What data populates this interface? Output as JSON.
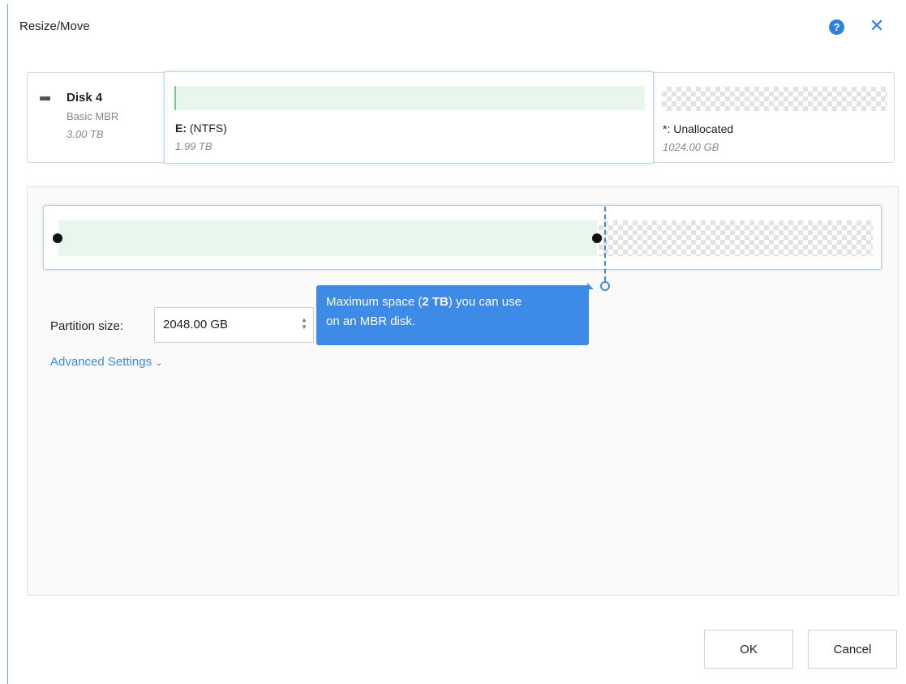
{
  "dialog": {
    "title": "Resize/Move"
  },
  "disk": {
    "name": "Disk 4",
    "type": "Basic MBR",
    "size": "3.00 TB"
  },
  "partition": {
    "letter": "E:",
    "fs": "(NTFS)",
    "size": "1.99 TB"
  },
  "unallocated": {
    "label": "*: Unallocated",
    "size": "1024.00 GB"
  },
  "slider": {
    "used_fraction": 0.664
  },
  "size_field": {
    "label": "Partition size:",
    "value": "2048.00 GB"
  },
  "tooltip": {
    "prefix": "Maximum space (",
    "bold": "2 TB",
    "suffix": ") you can use",
    "line2": "on an MBR disk."
  },
  "advanced": {
    "label": "Advanced Settings"
  },
  "buttons": {
    "ok": "OK",
    "cancel": "Cancel"
  },
  "icons": {
    "help": "help-icon",
    "close": "close-icon",
    "disk": "disk-icon",
    "chevron": "chevron-down-icon"
  },
  "colors": {
    "accent": "#3d8be6",
    "used_fill": "#e8f6ee"
  }
}
